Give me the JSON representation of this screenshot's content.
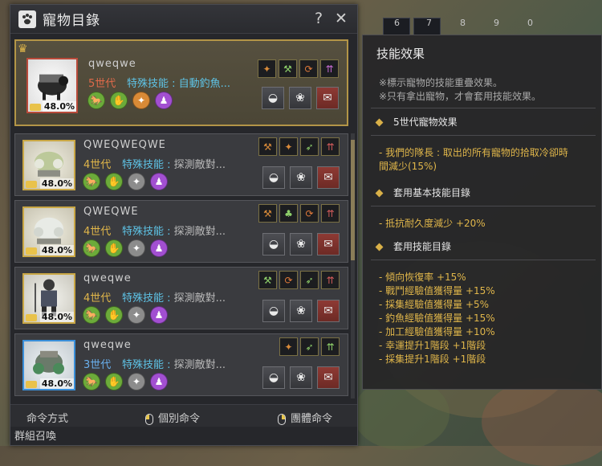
{
  "hud": {
    "slots": [
      "6",
      "7",
      "8",
      "9",
      "0"
    ]
  },
  "panel": {
    "title": "寵物目錄",
    "help": "?",
    "close": "✕",
    "pets": [
      {
        "name": "qweqwe",
        "gen": "5世代",
        "skill_label": "特殊技能 : ",
        "skill_value": "自動釣魚...",
        "pct": "48.0%",
        "skills": [
          "deer-icon",
          "pickaxe-icon",
          "fishing-icon",
          "arrows-icon"
        ],
        "circles": [
          "green",
          "green",
          "orange",
          "purple"
        ]
      },
      {
        "name": "QWEQWEQWE",
        "gen": "4世代",
        "skill_label": "特殊技能 : ",
        "skill_value": "探測敵對...",
        "pct": "48.0%",
        "skills": [
          "hammer-icon",
          "deer-icon",
          "wing-icon",
          "arrows-icon"
        ],
        "circles": [
          "green",
          "green",
          "gray",
          "purple"
        ]
      },
      {
        "name": "QWEQWE",
        "gen": "4世代",
        "skill_label": "特殊技能 : ",
        "skill_value": "探測敵對...",
        "pct": "48.0%",
        "skills": [
          "hammer-icon",
          "clover-icon",
          "fishing-icon",
          "arrows-icon"
        ],
        "circles": [
          "green",
          "green",
          "gray",
          "purple"
        ]
      },
      {
        "name": "qweqwe",
        "gen": "4世代",
        "skill_label": "特殊技能 : ",
        "skill_value": "探測敵對...",
        "pct": "48.0%",
        "skills": [
          "pickaxe-icon",
          "fishing-icon",
          "wing-icon",
          "arrows-icon"
        ],
        "circles": [
          "green",
          "green",
          "gray",
          "purple"
        ]
      },
      {
        "name": "qweqwe",
        "gen": "3世代",
        "skill_label": "特殊技能 : ",
        "skill_value": "探測敵對...",
        "pct": "48.0%",
        "skills": [
          "deer-icon",
          "wing-icon",
          "arrows-icon"
        ],
        "circles": [
          "green",
          "green",
          "gray",
          "purple"
        ]
      }
    ],
    "command_label": "命令方式",
    "individual_cmd": "個別命令",
    "group_cmd": "團體命令",
    "group_summon": "群組召喚"
  },
  "tooltip": {
    "title": "技能效果",
    "note1": "※標示寵物的技能重疊效果。",
    "note2": "※只有拿出寵物，才會套用技能效果。",
    "sec1_head": "5世代寵物效果",
    "sec1_line1": "- 我們的隊長 : 取出的所有寵物的拾取冷卻時",
    "sec1_line2": "間減少(15%)",
    "sec2_head": "套用基本技能目錄",
    "sec2_line1": "- 抵抗耐久度減少 +20%",
    "sec3_head": "套用技能目錄",
    "sec3_lines": [
      "- 傾向恢復率 +15%",
      "- 戰鬥經驗值獲得量 +15%",
      "- 採集經驗值獲得量 +5%",
      "- 釣魚經驗值獲得量 +15%",
      "- 加工經驗值獲得量 +10%",
      "- 幸運提升1階段 +1階段",
      "- 採集提升1階段 +1階段"
    ]
  },
  "colors": {
    "accent_gold": "#e0b64a",
    "skill_blue": "#5ec3e6",
    "gen_red": "#e06a4a"
  }
}
